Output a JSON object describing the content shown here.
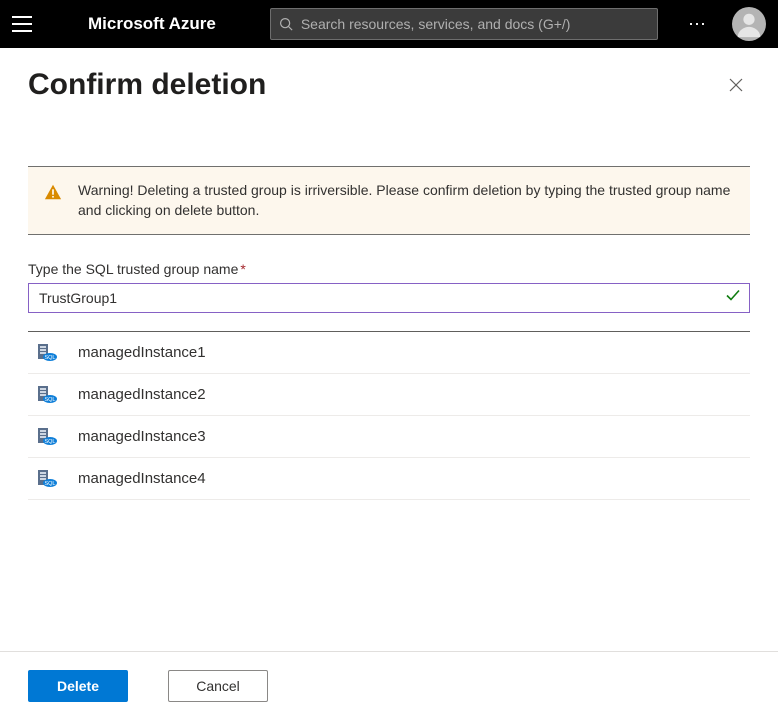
{
  "topbar": {
    "brand": "Microsoft Azure",
    "search_placeholder": "Search resources, services, and docs (G+/)"
  },
  "panel": {
    "title": "Confirm deletion"
  },
  "warning": {
    "text": "Warning! Deleting a trusted group is irriversible. Please confirm deletion by typing the trusted group name and clicking on delete button."
  },
  "form": {
    "label": "Type the SQL trusted group name",
    "value": "TrustGroup1"
  },
  "instances": [
    {
      "name": "managedInstance1"
    },
    {
      "name": "managedInstance2"
    },
    {
      "name": "managedInstance3"
    },
    {
      "name": "managedInstance4"
    }
  ],
  "footer": {
    "delete_label": "Delete",
    "cancel_label": "Cancel"
  }
}
